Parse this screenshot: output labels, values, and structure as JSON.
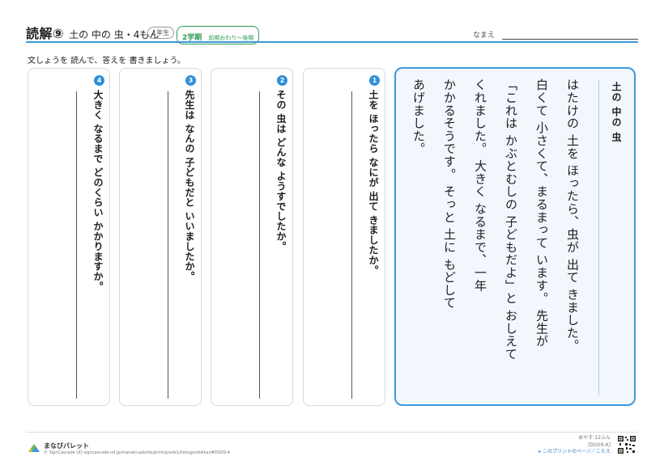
{
  "header": {
    "title": "読解⑨",
    "subtitle": "土の 中の 虫・4もん",
    "grade": "1年生",
    "term": "2学期",
    "term_detail": "前期おわり〜後期",
    "name_label": "なまえ"
  },
  "instruction": "文しょうを 読んで、答えを 書きましょう。",
  "questions": [
    {
      "number": "1",
      "text": "土を ほったら なにが 出て きましたか。"
    },
    {
      "number": "2",
      "text": "その 虫は どんな ようすでしたか。"
    },
    {
      "number": "3",
      "text": "先生は なんの 子どもだと いいましたか。"
    },
    {
      "number": "4",
      "text": "大きく なるまで どのくらい かかりますか。"
    }
  ],
  "story": {
    "title": "土の 中の 虫",
    "columns": [
      "はたけの 土を ほったら、虫が 出て きました。",
      "白くて 小さくて、まるまって います。 先生が",
      "「これは かぶとむしの 子どもだよ」と おしえて",
      "くれました。 大きく なるまで、一年",
      "かかるそうです。 そっと 土に もどして",
      "あげました。"
    ]
  },
  "footer": {
    "brand": "まなびパレット",
    "url": "© SignCascade UD  signcascade-ud.jp/manabi-palette/print/grade1/kokugo/dokkai/#DG09-A",
    "time": "めやす:12ふん",
    "code": "[DG09-A]",
    "answer_link": "▸ このプリントのページ／こたえ"
  },
  "colors": {
    "accent": "#3b9ad8",
    "number_badge": "#2f8fd8",
    "term_green": "#2e9a55",
    "story_background": "#f1f7fc"
  }
}
